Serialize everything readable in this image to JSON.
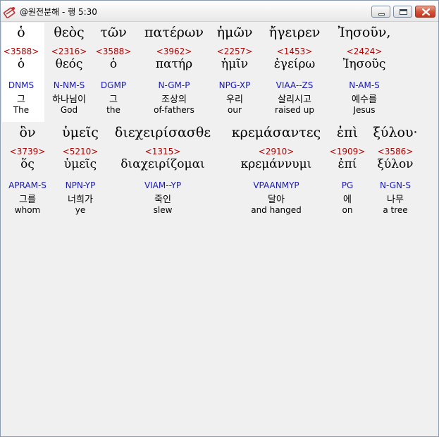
{
  "window": {
    "title": "@원전분해 - 행 5:30"
  },
  "verse_line_1": [
    {
      "greek": "ὁ",
      "strong": "<3588>",
      "lemma": "ὁ",
      "morph": "DNMS",
      "korean": "그",
      "english": "The"
    },
    {
      "greek": "θεὸς",
      "strong": "<2316>",
      "lemma": "θεός",
      "morph": "N-NM-S",
      "korean": "하나님이",
      "english": "God"
    },
    {
      "greek": "τῶν",
      "strong": "<3588>",
      "lemma": "ὁ",
      "morph": "DGMP",
      "korean": "그",
      "english": "the"
    },
    {
      "greek": "πατέρων",
      "strong": "<3962>",
      "lemma": "πατήρ",
      "morph": "N-GM-P",
      "korean": "조상의",
      "english": "of-fathers"
    },
    {
      "greek": "ἡμῶν",
      "strong": "<2257>",
      "lemma": "ἡμῖν",
      "morph": "NPG-XP",
      "korean": "우리",
      "english": "our"
    },
    {
      "greek": "ἤγειρεν",
      "strong": "<1453>",
      "lemma": "ἐγείρω",
      "morph": "VIAA--ZS",
      "korean": "살리시고",
      "english": "raised up"
    },
    {
      "greek": "Ἰησοῦν,",
      "strong": "<2424>",
      "lemma": "Ἰησοῦς",
      "morph": "N-AM-S",
      "korean": "예수를",
      "english": "Jesus"
    }
  ],
  "verse_line_2": [
    {
      "greek": "ὃν",
      "strong": "<3739>",
      "lemma": "ὅς",
      "morph": "APRAM-S",
      "korean": "그를",
      "english": "whom"
    },
    {
      "greek": "ὑμεῖς",
      "strong": "<5210>",
      "lemma": "ὑμεῖς",
      "morph": "NPN-YP",
      "korean": "너희가",
      "english": "ye"
    },
    {
      "greek": "διεχειρίσασθε",
      "strong": "<1315>",
      "lemma": "διαχειρίζομαι",
      "morph": "VIAM--YP",
      "korean": "죽인",
      "english": "slew"
    },
    {
      "greek": "κρεμάσαντες",
      "strong": "<2910>",
      "lemma": "κρεμάννυμι",
      "morph": "VPAANMYP",
      "korean": "달아",
      "english": "and hanged"
    },
    {
      "greek": "ἐπὶ",
      "strong": "<1909>",
      "lemma": "ἐπί",
      "morph": "PG",
      "korean": "에",
      "english": "on"
    },
    {
      "greek": "ξύλου·",
      "strong": "<3586>",
      "lemma": "ξύλον",
      "morph": "N-GN-S",
      "korean": "나무",
      "english": "a tree"
    }
  ]
}
